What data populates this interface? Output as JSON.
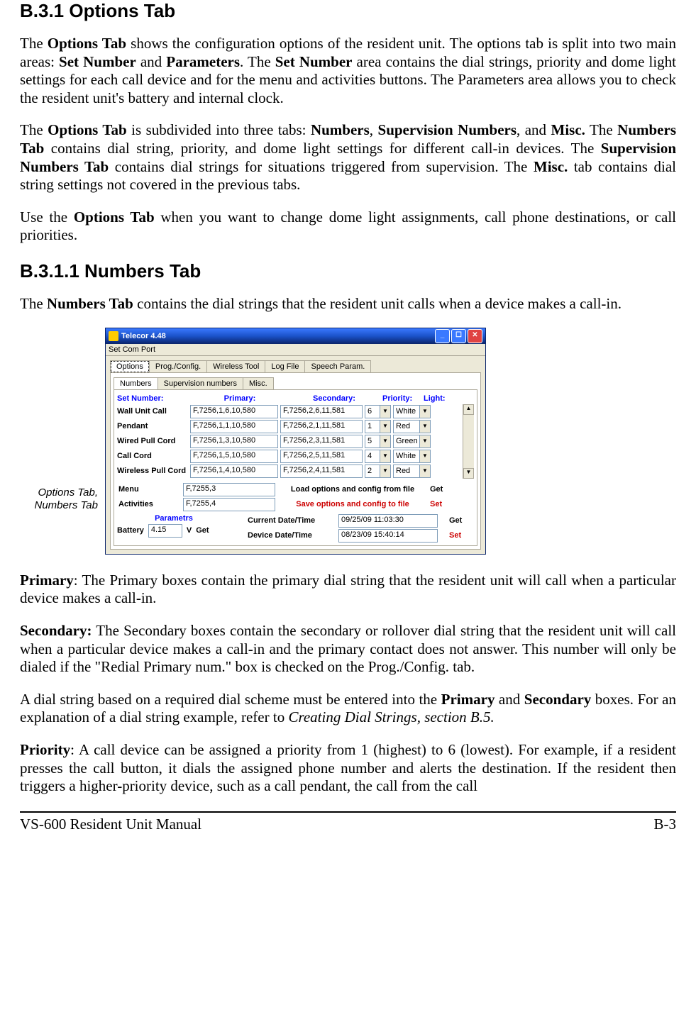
{
  "heading_b31": "B.3.1        Options Tab",
  "p1_a": "The ",
  "p1_b": "Options Tab",
  "p1_c": " shows the configuration options of the resident unit.  The options tab is split into two main areas: ",
  "p1_d": "Set Number",
  "p1_e": " and ",
  "p1_f": "Parameters",
  "p1_g": ".  The ",
  "p1_h": "Set Number",
  "p1_i": " area contains the dial strings, priority and dome light settings for each call device and for the menu and activities buttons.  The Parameters area allows you to check the resident unit's battery and internal clock.",
  "p2_a": "The ",
  "p2_b": "Options Tab",
  "p2_c": " is subdivided into three tabs: ",
  "p2_d": "Numbers",
  "p2_e": ", ",
  "p2_f": "Supervision Numbers",
  "p2_g": ", and ",
  "p2_h": "Misc.",
  "p2_i": " The ",
  "p2_j": "Numbers Tab",
  "p2_k": " contains dial string, priority, and dome light settings for different call-in devices.  The ",
  "p2_l": "Supervision Numbers Tab",
  "p2_m": " contains dial strings for situations triggered  from supervision.  The ",
  "p2_n": "Misc.",
  "p2_o": " tab contains dial string settings not covered in the previous tabs.",
  "p3_a": "Use the ",
  "p3_b": "Options Tab",
  "p3_c": " when you want to change dome light assignments, call phone destinations, or call priorities.",
  "heading_b311": "B.3.1.1      Numbers Tab",
  "p4_a": "The ",
  "p4_b": "Numbers Tab",
  "p4_c": " contains the dial strings that the resident unit calls when a device makes a call-in.",
  "caption_l1": "Options Tab,",
  "caption_l2": "Numbers Tab",
  "win": {
    "title": "Telecor 4.48",
    "menu": "Set Com Port",
    "tabs1": [
      "Options",
      "Prog./Config.",
      "Wireless Tool",
      "Log File",
      "Speech Param."
    ],
    "tabs2": [
      "Numbers",
      "Supervision numbers",
      "Misc."
    ],
    "headers": {
      "c1": "Set Number:",
      "c2": "Primary:",
      "c3": "Secondary:",
      "c4": "Priority:",
      "c5": "Light:"
    },
    "rows": [
      {
        "label": "Wall Unit Call",
        "primary": "F,7256,1,6,10,580",
        "secondary": "F,7256,2,6,11,581",
        "priority": "6",
        "light": "White"
      },
      {
        "label": "Pendant",
        "primary": "F,7256,1,1,10,580",
        "secondary": "F,7256,2,1,11,581",
        "priority": "1",
        "light": "Red"
      },
      {
        "label": "Wired Pull Cord",
        "primary": "F,7256,1,3,10,580",
        "secondary": "F,7256,2,3,11,581",
        "priority": "5",
        "light": "Green"
      },
      {
        "label": "Call Cord",
        "primary": "F,7256,1,5,10,580",
        "secondary": "F,7256,2,5,11,581",
        "priority": "4",
        "light": "White"
      },
      {
        "label": "Wireless Pull Cord",
        "primary": "F,7256,1,4,10,580",
        "secondary": "F,7256,2,4,11,581",
        "priority": "2",
        "light": "Red"
      }
    ],
    "menu_lbl": "Menu",
    "menu_val": "F,7255,3",
    "act_lbl": "Activities",
    "act_val": "F,7255,4",
    "load_lbl": "Load  options and config from file",
    "get_lbl": "Get",
    "save_lbl": "Save options and config to file",
    "set_lbl": "Set",
    "param_lbl": "Parametrs",
    "bat_lbl": "Battery",
    "bat_val": "4.15",
    "bat_unit": "V",
    "bat_get": "Get",
    "cdt_lbl": "Current Date/Time",
    "cdt_val": "09/25/09   11:03:30",
    "ddt_lbl": "Device Date/Time",
    "ddt_val": "08/23/09   15:40:14",
    "getset_get": "Get",
    "getset_set": "Set"
  },
  "p5_a": "Primary",
  "p5_b": ": The Primary boxes contain the primary dial string that the resident unit will call when a particular device makes a call-in.",
  "p6_a": "Secondary:",
  "p6_b": " The Secondary boxes contain the secondary or rollover dial string that the resident unit will call when a particular device makes a call-in and the primary contact does not answer. This number will only be dialed if the \"Redial Primary num.\" box is checked on the Prog./Config. tab.",
  "p7_a": "A dial string based on a required dial scheme must be entered into the ",
  "p7_b": "Primary",
  "p7_c": " and ",
  "p7_d": "Secondary",
  "p7_e": " boxes.  For an explanation of a dial string example, refer to ",
  "p7_f": "Creating Dial Strings, section B.5.",
  "p8_a": "Priority",
  "p8_b": ":  A call device can be assigned a priority from 1 (highest) to 6 (lowest). For example, if a resident presses the call button, it dials the assigned phone number and alerts the destination. If the resident then triggers a higher-priority device, such as a call pendant, the call from the call",
  "footer_left": "VS-600 Resident Unit Manual",
  "footer_right": "B-3"
}
